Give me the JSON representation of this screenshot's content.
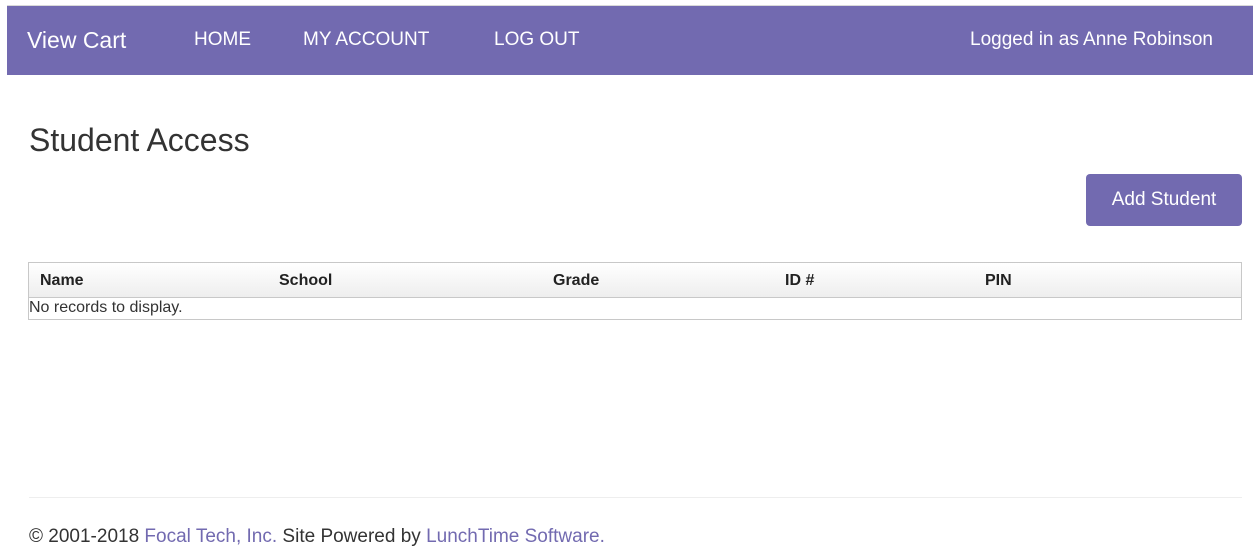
{
  "navbar": {
    "brand": "View Cart",
    "links": [
      {
        "label": "HOME"
      },
      {
        "label": "MY ACCOUNT"
      },
      {
        "label": "LOG OUT"
      }
    ],
    "user_text": "Logged in as Anne Robinson"
  },
  "main": {
    "title": "Student Access",
    "add_button_label": "Add Student",
    "table": {
      "columns": [
        "Name",
        "School",
        "Grade",
        "ID #",
        "PIN"
      ],
      "rows": [],
      "empty_message": "No records to display."
    }
  },
  "footer": {
    "copyright": "© 2001-2018",
    "company_link": "Focal Tech, Inc.",
    "powered_text": "Site Powered by",
    "software_link": "LunchTime Software."
  },
  "colors": {
    "brand": "#726ab0",
    "navbar_text": "#ffffff"
  }
}
